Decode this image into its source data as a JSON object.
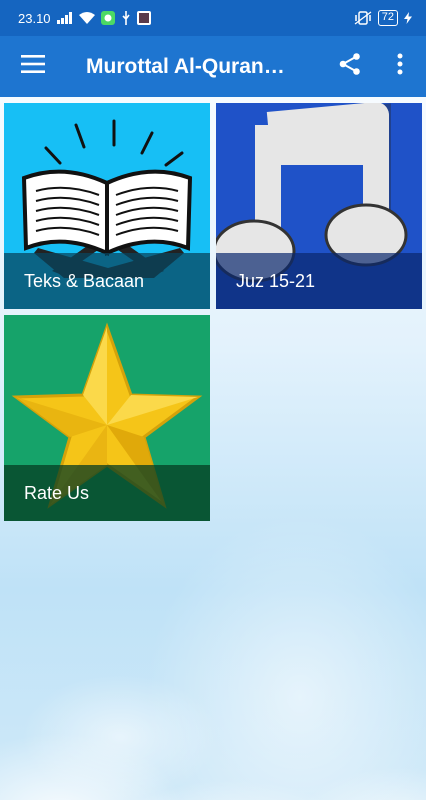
{
  "status_bar": {
    "time": "23.10",
    "battery": "72"
  },
  "app_bar": {
    "title": "Murottal Al-Quran…"
  },
  "tiles": [
    {
      "label": "Teks & Bacaan"
    },
    {
      "label": "Juz 15-21"
    },
    {
      "label": "Rate Us"
    }
  ],
  "colors": {
    "status_bar": "#1565c0",
    "app_bar": "#1e75d0",
    "tile_quran": "#17bff5",
    "tile_music": "#1f52c8",
    "tile_rate": "#16a36a"
  },
  "icons": [
    "menu-icon",
    "share-icon",
    "more-vert-icon",
    "signal-icon",
    "wifi-icon",
    "vibrate-icon",
    "battery-icon",
    "charging-icon"
  ]
}
